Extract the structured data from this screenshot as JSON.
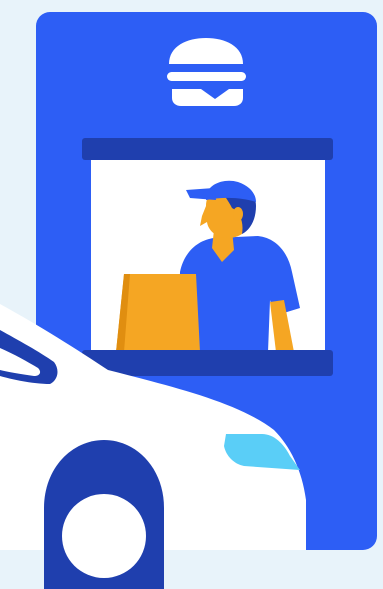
{
  "illustration": {
    "subject": "drive-through-window",
    "icons": [
      "burger-icon"
    ]
  },
  "colors": {
    "background": "#E8F3FA",
    "building": "#2D5EF5",
    "ledge": "#1F3FAE",
    "window_interior": "#FFFFFF",
    "worker_shirt": "#2D5EF5",
    "worker_cap": "#2D5EF5",
    "worker_skin": "#F5A623",
    "worker_hair": "#1F3FAE",
    "paper_bag": "#F5A623",
    "paper_bag_shade": "#E08E10",
    "car_body": "#FFFFFF",
    "car_outline": "#1F3FAE",
    "car_headlight": "#5ACEF7",
    "tire": "#1F3FAE"
  }
}
